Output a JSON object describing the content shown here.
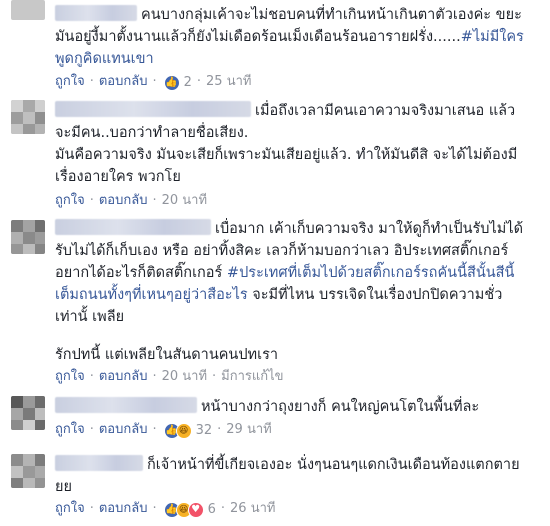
{
  "comments": [
    {
      "lines": [
        "คนบางกลุ่มเค้าจะไม่ชอบคนที่ทำเกินหน้าเกินตาตัวเองค่ะ ขยะ",
        "มันอยู่งี้มาตั้งนานแล้วก็ยังไม่เดือดร้อนเม็งเดือนร้อนอารายฝรั่ง......",
        "พูดกูคิดแทนเขา"
      ],
      "hashtag": "#ไม่มีใคร",
      "actions": {
        "like": "ถูกใจ",
        "reply": "ตอบกลับ",
        "count": "2",
        "time": "25 นาที"
      },
      "reaction_icons": [
        "like-icon"
      ]
    },
    {
      "lines": [
        "เมื่อถึงเวลามีคนเอาความจริงมาเสนอ แล้ว",
        "จะมีคน..บอกว่าทำลายชื่อเสียง.",
        "มันคือความจริง มันจะเสียก็เพราะมันเสียอยู่แล้ว. ทำให้มันดีสิ จะได้ไม่ต้องมี",
        "เรื่องอายใคร พวกโย"
      ],
      "actions": {
        "like": "ถูกใจ",
        "reply": "ตอบกลับ",
        "time": "20 นาที"
      }
    },
    {
      "lines": [
        "เบื่อมาก เค้าเก็บความจริง มาให้ดูก็ทำเป็นรับไม่ได้",
        "รับไม่ได้ก็เก็บเอง หรือ อย่าทิ้งสิคะ เลวก็ห้ามบอกว่าเลว อิประเทศสติ๊กเกอร์",
        "อยากได้อะไรก็ติดสติ๊กเกอร์",
        "เต็มถนนทั้งๆที่เหนๆอยู่ว่าสือะไร",
        "เท่านั้ เพลีย",
        "รักปทนี้ แต่เพลียในสันดานคนปทเรา"
      ],
      "hashtag": "#ประเทศที่เต็มไปด้วยสติ๊กเกอร์รถคันนี้สีนั้นสีนี้",
      "hashtag_suffix": " จะมีที่ไหน บรรเจิดในเรื่องปกปิดความชั่ว",
      "actions": {
        "like": "ถูกใจ",
        "reply": "ตอบกลับ",
        "time": "20 นาที",
        "edited": "มีการแก้ไข"
      }
    },
    {
      "lines": [
        "หน้าบางกว่าถุงยางก็ คนใหญ่คนโตในพื้นที่ละ"
      ],
      "actions": {
        "like": "ถูกใจ",
        "reply": "ตอบกลับ",
        "count": "32",
        "time": "29 นาที"
      },
      "reaction_icons": [
        "like-icon",
        "haha-icon"
      ]
    },
    {
      "lines": [
        "ก็เจ้าหน้าที่ขี้เกียจเองอะ นั่งๆนอนๆแดกเงินเดือนท้องแตกตาย",
        "ยย"
      ],
      "actions": {
        "like": "ถูกใจ",
        "reply": "ตอบกลับ",
        "count": "6",
        "time": "26 นาที"
      },
      "reaction_icons": [
        "like-icon",
        "haha-icon",
        "love-icon"
      ]
    }
  ],
  "colors": {
    "link": "#385898",
    "meta": "#90949c",
    "text": "#1d2129",
    "like": "#4267b2"
  }
}
